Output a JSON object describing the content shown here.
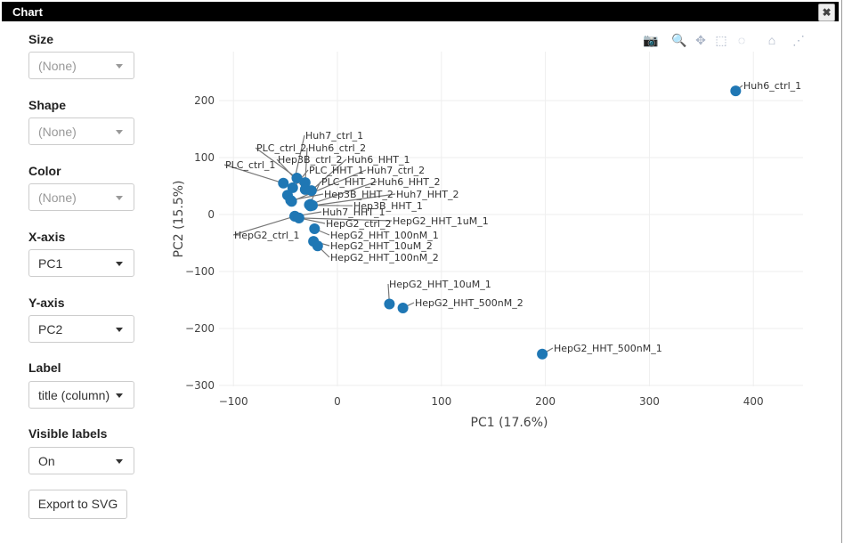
{
  "window": {
    "title": "Chart",
    "close_label": "✖"
  },
  "controls": {
    "size": {
      "label": "Size",
      "value": "(None)"
    },
    "shape": {
      "label": "Shape",
      "value": "(None)"
    },
    "color": {
      "label": "Color",
      "value": "(None)"
    },
    "xaxis": {
      "label": "X-axis",
      "value": "PC1"
    },
    "yaxis": {
      "label": "Y-axis",
      "value": "PC2"
    },
    "label": {
      "label": "Label",
      "value": "title (column)"
    },
    "visible_labels": {
      "label": "Visible labels",
      "value": "On"
    },
    "export_label": "Export to SVG"
  },
  "modebar": [
    {
      "name": "camera-icon",
      "glyph": "📷"
    },
    {
      "name": "zoom-icon",
      "glyph": "🔍"
    },
    {
      "name": "pan-icon",
      "glyph": "✥"
    },
    {
      "name": "box-select-icon",
      "glyph": "⬚"
    },
    {
      "name": "lasso-select-icon",
      "glyph": "◌"
    },
    {
      "name": "home-icon",
      "glyph": "⌂"
    },
    {
      "name": "spike-lines-icon",
      "glyph": "⋰"
    }
  ],
  "chart_data": {
    "type": "scatter",
    "xlabel": "PC1 (17.6%)",
    "ylabel": "PC2 (15.5%)",
    "xlim": [
      -115,
      450
    ],
    "ylim": [
      -302,
      242
    ],
    "xticks": [
      -100,
      0,
      100,
      200,
      300,
      400
    ],
    "yticks": [
      -300,
      -200,
      -100,
      0,
      100,
      200
    ],
    "grid": true,
    "marker_color": "#1f77b4",
    "points": [
      {
        "label": "Huh6_ctrl_1",
        "x": 383,
        "y": 217
      },
      {
        "label": "PLC_ctrl_1",
        "x": -52,
        "y": 55
      },
      {
        "label": "PLC_ctrl_2",
        "x": -39,
        "y": 64
      },
      {
        "label": "Huh6_ctrl_2",
        "x": -31,
        "y": 56
      },
      {
        "label": "Huh7_ctrl_1",
        "x": -43,
        "y": 47
      },
      {
        "label": "Hep3B_ctrl_2",
        "x": -31,
        "y": 44
      },
      {
        "label": "Huh6_HHT_1",
        "x": -25,
        "y": 42
      },
      {
        "label": "PLC_HHT_1",
        "x": -48,
        "y": 34
      },
      {
        "label": "Huh7_ctrl_2",
        "x": -44,
        "y": 23
      },
      {
        "label": "PLC_HHT_2",
        "x": -27,
        "y": 17
      },
      {
        "label": "Huh6_HHT_2",
        "x": -26,
        "y": 18
      },
      {
        "label": "Hep3B_HHT_2",
        "x": -45,
        "y": 25
      },
      {
        "label": "Huh7_HHT_2",
        "x": -26,
        "y": 15
      },
      {
        "label": "Hep3B_HHT_1",
        "x": -24,
        "y": 16
      },
      {
        "label": "Huh7_HHT_1",
        "x": -41,
        "y": -3
      },
      {
        "label": "HepG2_ctrl_1",
        "x": -41,
        "y": -3
      },
      {
        "label": "HepG2_ctrl_2",
        "x": -37,
        "y": -6
      },
      {
        "label": "HepG2_HHT_1uM_1",
        "x": -37,
        "y": -6
      },
      {
        "label": "HepG2_HHT_100nM_1",
        "x": -22,
        "y": -25
      },
      {
        "label": "HepG2_HHT_10uM_2",
        "x": -23,
        "y": -47
      },
      {
        "label": "HepG2_HHT_100nM_2",
        "x": -19,
        "y": -55
      },
      {
        "label": "HepG2_HHT_10uM_1",
        "x": 50,
        "y": -157
      },
      {
        "label": "HepG2_HHT_500nM_2",
        "x": 63,
        "y": -164
      },
      {
        "label": "HepG2_HHT_500nM_1",
        "x": 197,
        "y": -245
      }
    ]
  }
}
